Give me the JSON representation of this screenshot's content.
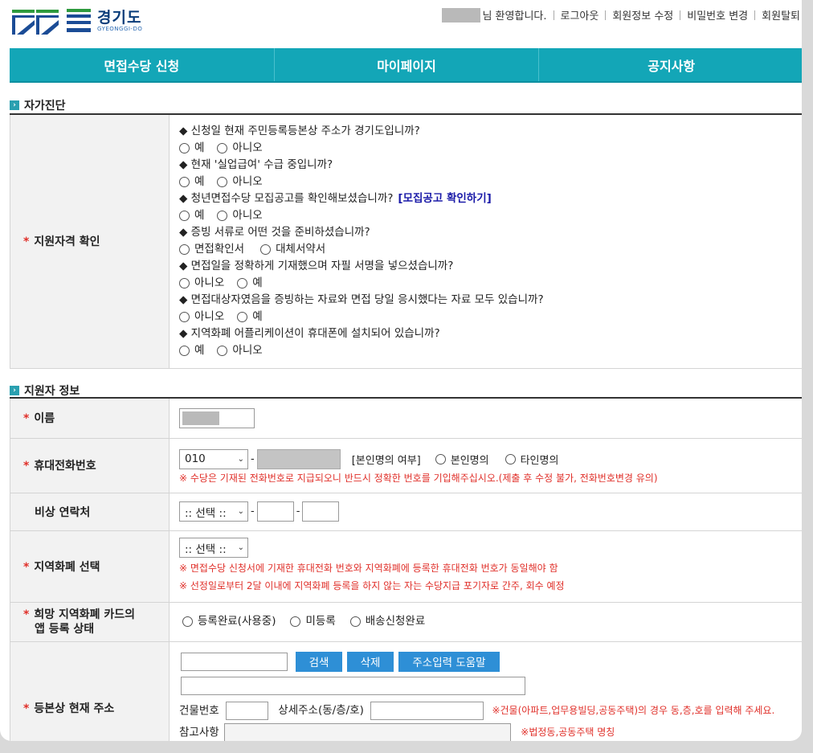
{
  "header": {
    "logo_text": "경기도",
    "logo_sub": "GYEONGGI-DO",
    "welcome": "님 환영합니다.",
    "links": [
      "로그아웃",
      "회원정보 수정",
      "비밀번호 변경",
      "회원탈퇴"
    ]
  },
  "nav": [
    "면접수당 신청",
    "마이페이지",
    "공지사항"
  ],
  "self_check": {
    "title": "자가진단",
    "label": "지원자격 확인",
    "questions": [
      {
        "q": "◆ 신청일 현재 주민등록등본상 주소가 경기도입니까?",
        "options": [
          "예",
          "아니오"
        ]
      },
      {
        "q": "◆ 현재 '실업급여' 수급 중입니까?",
        "options": [
          "예",
          "아니오"
        ]
      },
      {
        "q": "◆ 청년면접수당 모집공고를 확인해보셨습니까?",
        "link": "[모집공고 확인하기]",
        "options": [
          "예",
          "아니오"
        ]
      },
      {
        "q": "◆ 증빙 서류로 어떤 것을 준비하셨습니까?",
        "options": [
          "면접확인서",
          "대체서약서"
        ]
      },
      {
        "q": "◆ 면접일을 정확하게 기재했으며 자필 서명을 넣으셨습니까?",
        "options": [
          "아니오",
          "예"
        ]
      },
      {
        "q": "◆ 면접대상자였음을 증빙하는 자료와 면접 당일 응시했다는 자료 모두 있습니까?",
        "options": [
          "아니오",
          "예"
        ]
      },
      {
        "q": "◆ 지역화폐 어플리케이션이 휴대폰에 설치되어 있습니까?",
        "options": [
          "예",
          "아니오"
        ]
      }
    ]
  },
  "applicant": {
    "title": "지원자 정보",
    "name_label": "이름",
    "phone_label": "휴대전화번호",
    "phone_prefix": "010",
    "phone_identity_label": "[본인명의 여부]",
    "phone_identity_options": [
      "본인명의",
      "타인명의"
    ],
    "phone_warning": "※ 수당은 기재된 전화번호로 지급되오니 반드시 정확한 번호를 기입해주십시오.(제출 후 수정 불가, 전화번호변경 유의)",
    "emergency_label": "비상 연락처",
    "select_placeholder": ":: 선택 ::",
    "currency_label": "지역화폐 선택",
    "currency_warnings": [
      "※ 면접수당 신청서에 기재한 휴대전화 번호와 지역화폐에 등록한 휴대전화 번호가 동일해야 함",
      "※ 선정일로부터 2달 이내에 지역화폐 등록을 하지 않는 자는 수당지급 포기자로 간주, 회수 예정"
    ],
    "card_label_line1": "희망 지역화폐 카드의",
    "card_label_line2": "앱 등록 상태",
    "card_options": [
      "등록완료(사용중)",
      "미등록",
      "배송신청완료"
    ],
    "address_label": "등본상 현재 주소",
    "search_btn": "검색",
    "delete_btn": "삭제",
    "help_btn": "주소입력 도움말",
    "building_no_label": "건물번호",
    "detail_addr_label": "상세주소(동/층/호)",
    "addr_warning": "※건물(아파트,업무용빌딩,공동주택)의 경우 동,층,호를 입력해 주세요.",
    "ref_label": "참고사항",
    "ref_warning": "※법정동,공동주택 명칭"
  }
}
